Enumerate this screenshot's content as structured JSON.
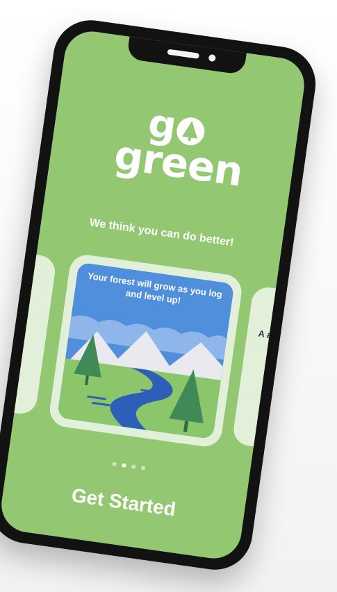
{
  "brand": {
    "logo_line1": "g",
    "logo_line2": "green",
    "logo_icon": "tree-icon"
  },
  "onboarding": {
    "tagline": "We think you can do better!",
    "slides": [
      {
        "caption": ""
      },
      {
        "caption": "Your forest will grow as you log and level up!"
      },
      {
        "caption": "A\na"
      }
    ],
    "active_slide": 1,
    "dot_count": 4
  },
  "cta": {
    "label": "Get Started"
  },
  "colors": {
    "screen_bg": "#93c772",
    "card_bg": "#e2f0d9",
    "sky": "#4f8fdb",
    "river": "#2d5fb8",
    "tree": "#3f8a57",
    "grass": "#8cc66a",
    "mountain": "#e9e9ef"
  }
}
